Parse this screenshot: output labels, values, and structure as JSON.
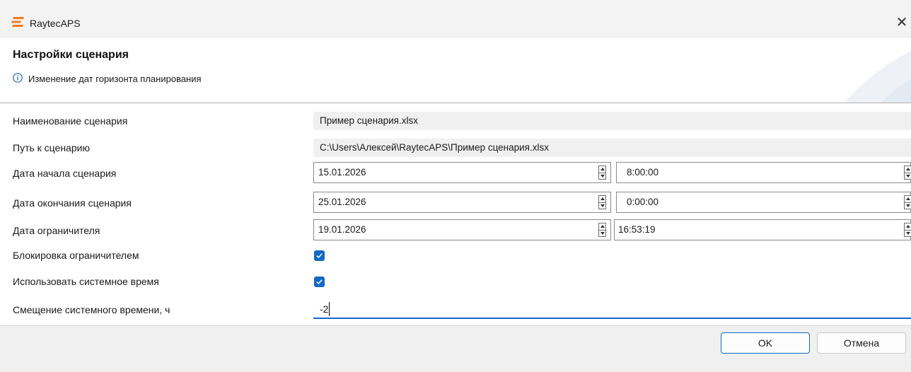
{
  "window": {
    "title": "RaytecAPS",
    "close_glyph": "✕"
  },
  "header": {
    "title": "Настройки сценария",
    "subtitle": "Изменение дат горизонта планирования"
  },
  "fields": {
    "name": {
      "label": "Наименование сценария",
      "value": "Пример сценария.xlsx"
    },
    "path": {
      "label": "Путь к сценарию",
      "value": "C:\\Users\\Алексей\\RaytecAPS\\Пример сценария.xlsx"
    },
    "start": {
      "label": "Дата начала сценария",
      "date": "15.01.2026",
      "time": "8:00:00"
    },
    "end": {
      "label": "Дата окончания сценария",
      "date": "25.01.2026",
      "time": "0:00:00"
    },
    "limiter": {
      "label": "Дата ограничителя",
      "date": "19.01.2026",
      "time": "16:53:19"
    },
    "lock_by_limiter": {
      "label": "Блокировка ограничителем",
      "checked": true
    },
    "use_system_time": {
      "label": "Использовать системное время",
      "checked": true
    },
    "system_time_offset": {
      "label": "Смещение системного времени, ч",
      "value": "-2"
    }
  },
  "buttons": {
    "ok": "OK",
    "cancel": "Отмена"
  },
  "colors": {
    "accent": "#1368c4",
    "logo": "#f07a1a",
    "info": "#1368c4"
  }
}
